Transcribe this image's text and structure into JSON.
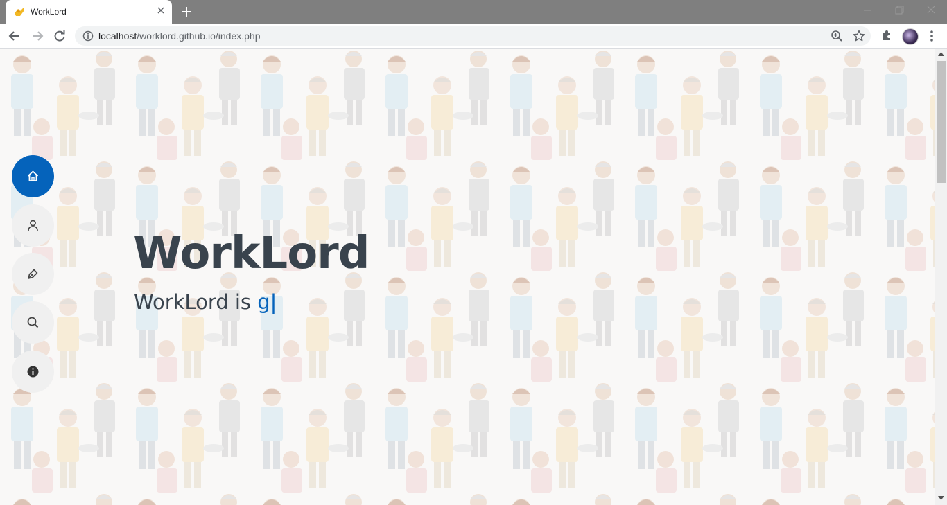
{
  "browser": {
    "tab_title": "WorkLord",
    "url_host": "localhost",
    "url_path": "/worklord.github.io/index.php"
  },
  "icons": {
    "tab": "worklord-favicon",
    "nav": [
      "back-icon",
      "forward-icon",
      "reload-icon"
    ],
    "omnibox": [
      "info-icon",
      "zoom-icon",
      "star-icon"
    ],
    "toolbar": [
      "extensions-icon",
      "profile-avatar",
      "menu-icon"
    ]
  },
  "hero": {
    "title": "WorkLord",
    "subtitle_prefix": "WorkLord is ",
    "subtitle_typed": "g",
    "cursor": "|"
  },
  "side_nav": {
    "items": [
      {
        "name": "home",
        "icon": "home-icon",
        "active": true
      },
      {
        "name": "about",
        "icon": "person-icon",
        "active": false
      },
      {
        "name": "services",
        "icon": "pen-icon",
        "active": false
      },
      {
        "name": "search",
        "icon": "search-icon",
        "active": false
      },
      {
        "name": "info",
        "icon": "info-circle-icon",
        "active": false
      }
    ]
  },
  "colors": {
    "accent": "#0563bb",
    "heading": "#39434d",
    "tabstrip": "#7f7f7f",
    "nav_circle": "#f0f0f0"
  }
}
